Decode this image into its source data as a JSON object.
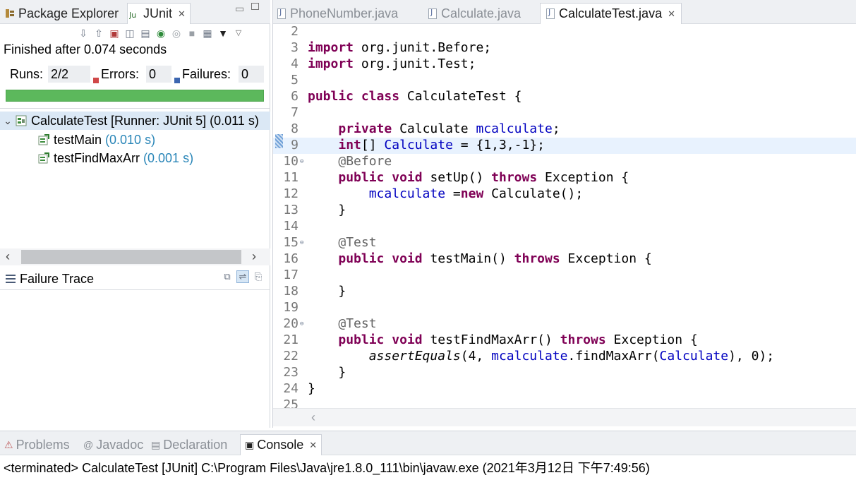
{
  "left_panel": {
    "tabs": [
      {
        "label": "Package Explorer",
        "icon": "package-icon"
      },
      {
        "label": "JUnit",
        "icon": "junit-icon",
        "active": true
      }
    ],
    "status": "Finished after 0.074 seconds",
    "counters": {
      "runs_label": "Runs:",
      "runs_value": "2/2",
      "errors_label": "Errors:",
      "errors_value": "0",
      "failures_label": "Failures:",
      "failures_value": "0"
    },
    "progress": {
      "fraction": 1.0,
      "color": "#5cb85c"
    },
    "tree": {
      "root": {
        "label": "CalculateTest [Runner: JUnit 5] (0.011 s)",
        "icon": "test-suite-icon",
        "expanded": true
      },
      "children": [
        {
          "name": "testMain",
          "time": "(0.010 s)",
          "icon": "test-pass-icon"
        },
        {
          "name": "testFindMaxArr",
          "time": "(0.001 s)",
          "icon": "test-pass-icon"
        }
      ]
    },
    "failure_trace": {
      "title": "Failure Trace"
    }
  },
  "editor": {
    "tabs": [
      {
        "label": "PhoneNumber.java",
        "active": false
      },
      {
        "label": "Calculate.java",
        "active": false
      },
      {
        "label": "CalculateTest.java",
        "active": true
      }
    ],
    "current_line": 9,
    "code_lines": [
      {
        "n": "2",
        "text": ""
      },
      {
        "n": "3",
        "text": "import org.junit.Before;"
      },
      {
        "n": "4",
        "text": "import org.junit.Test;"
      },
      {
        "n": "5",
        "text": ""
      },
      {
        "n": "6",
        "text": "public class CalculateTest {"
      },
      {
        "n": "7",
        "text": ""
      },
      {
        "n": "8",
        "text": "    private Calculate mcalculate;"
      },
      {
        "n": "9",
        "text": "    int[] Calculate = {1,3,-1};"
      },
      {
        "n": "10",
        "text": "    @Before"
      },
      {
        "n": "11",
        "text": "    public void setUp() throws Exception {"
      },
      {
        "n": "12",
        "text": "        mcalculate =new Calculate();"
      },
      {
        "n": "13",
        "text": "    }"
      },
      {
        "n": "14",
        "text": ""
      },
      {
        "n": "15",
        "text": "    @Test"
      },
      {
        "n": "16",
        "text": "    public void testMain() throws Exception {"
      },
      {
        "n": "17",
        "text": ""
      },
      {
        "n": "18",
        "text": "    }"
      },
      {
        "n": "19",
        "text": ""
      },
      {
        "n": "20",
        "text": "    @Test"
      },
      {
        "n": "21",
        "text": "    public void testFindMaxArr() throws Exception {"
      },
      {
        "n": "22",
        "text": "        assertEquals(4, mcalculate.findMaxArr(Calculate), 0);"
      },
      {
        "n": "23",
        "text": "    }"
      },
      {
        "n": "24",
        "text": "}"
      },
      {
        "n": "25",
        "text": ""
      }
    ]
  },
  "bottom": {
    "tabs": [
      {
        "label": "Problems",
        "icon": "problems-icon"
      },
      {
        "label": "Javadoc",
        "icon": "javadoc-icon"
      },
      {
        "label": "Declaration",
        "icon": "declaration-icon"
      },
      {
        "label": "Console",
        "icon": "console-icon",
        "active": true
      }
    ],
    "console_text": "<terminated> CalculateTest [JUnit] C:\\Program Files\\Java\\jre1.8.0_111\\bin\\javaw.exe (2021年3月12日 下午7:49:56)"
  },
  "colors": {
    "keyword": "#7f0055",
    "field": "#0000c0",
    "annotation": "#646464",
    "time": "#2a86b8",
    "progress": "#5cb85c",
    "current_line": "#e8f2fe"
  }
}
